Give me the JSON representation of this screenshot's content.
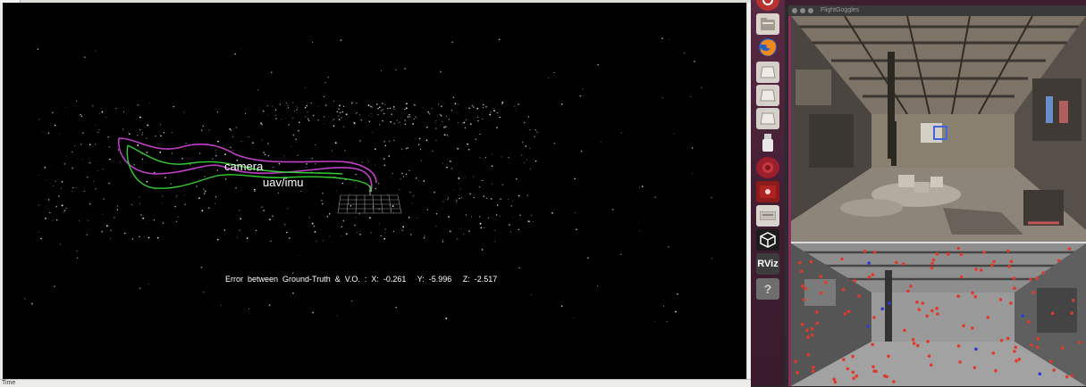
{
  "rviz": {
    "status_time": "Time",
    "markers": {
      "camera": "camera",
      "imu": "uav/imu"
    },
    "error_readout": "Error  between  Ground-Truth  &  V.O.  :  X:  -0.261     Y:  -5.996     Z:  -2.517",
    "trajectory_colors": {
      "ground_truth": "#c040c8",
      "visual_odometry": "#33cc33"
    }
  },
  "launcher": {
    "items": [
      {
        "name": "settings-icon"
      },
      {
        "name": "files-icon"
      },
      {
        "name": "firefox-icon"
      },
      {
        "name": "window-1-icon"
      },
      {
        "name": "window-2-icon"
      },
      {
        "name": "window-3-icon"
      },
      {
        "name": "usb-drive-icon"
      },
      {
        "name": "app-red-icon"
      },
      {
        "name": "screen-recorder-icon"
      },
      {
        "name": "keyboard-icon"
      },
      {
        "name": "unity-icon"
      },
      {
        "name": "rviz-icon",
        "label": "RViz"
      },
      {
        "name": "help-icon"
      }
    ],
    "background": "#4a2339"
  },
  "flightgoggles": {
    "title": "FlightGoggles"
  }
}
